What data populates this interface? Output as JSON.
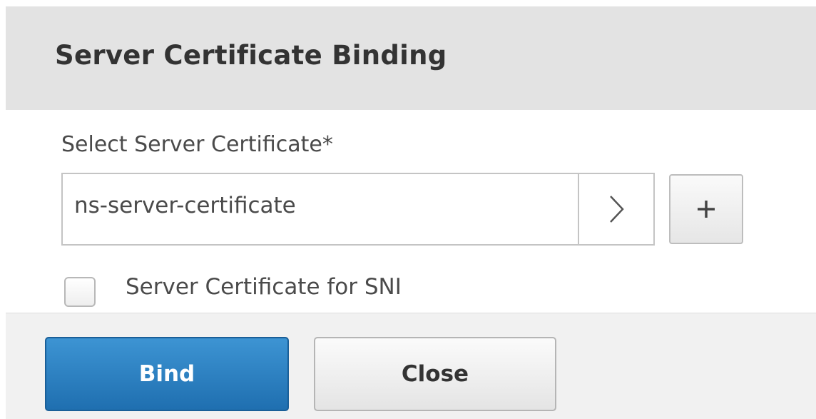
{
  "dialog": {
    "title": "Server Certificate Binding"
  },
  "form": {
    "select_label": "Select Server Certificate*",
    "select_value": "ns-server-certificate",
    "checkbox_label": "Server Certificate for SNI",
    "checkbox_checked": false
  },
  "footer": {
    "bind_label": "Bind",
    "close_label": "Close"
  },
  "colors": {
    "primary": "#2a7fc1",
    "header_bg": "#e3e3e3"
  },
  "icons": {
    "select_arrow": "chevron-right-icon",
    "add": "plus-icon"
  }
}
